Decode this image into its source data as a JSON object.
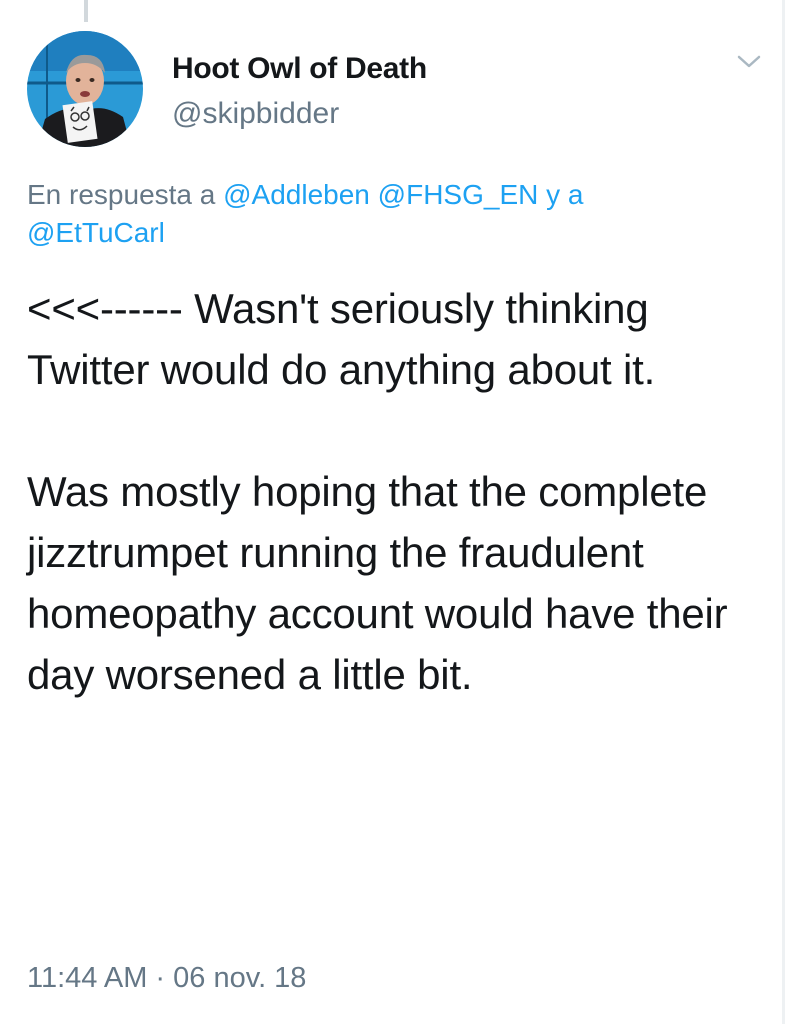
{
  "tweet": {
    "author": {
      "name": "Hoot Owl of Death",
      "handle": "@skipbidder",
      "avatar_icon": "profile-photo"
    },
    "reply_to": {
      "prefix": "En respuesta a",
      "users": [
        "@Addleben",
        "@FHSG_EN"
      ],
      "joiner": "y a",
      "last_user": "@EtTuCarl"
    },
    "text": {
      "paragraph_1": "<<<------ Wasn't seriously thinking Twitter would do anything about it.",
      "paragraph_2": "Was mostly hoping that the complete jizztrumpet running the fraudulent homeopathy account would have their day worsened a little bit."
    },
    "timestamp": "11:44 AM · 06 nov. 18"
  },
  "colors": {
    "link": "#1da1f2",
    "secondary_text": "#657786",
    "primary_text": "#14171a"
  },
  "icons": {
    "menu": "chevron-down-icon"
  }
}
